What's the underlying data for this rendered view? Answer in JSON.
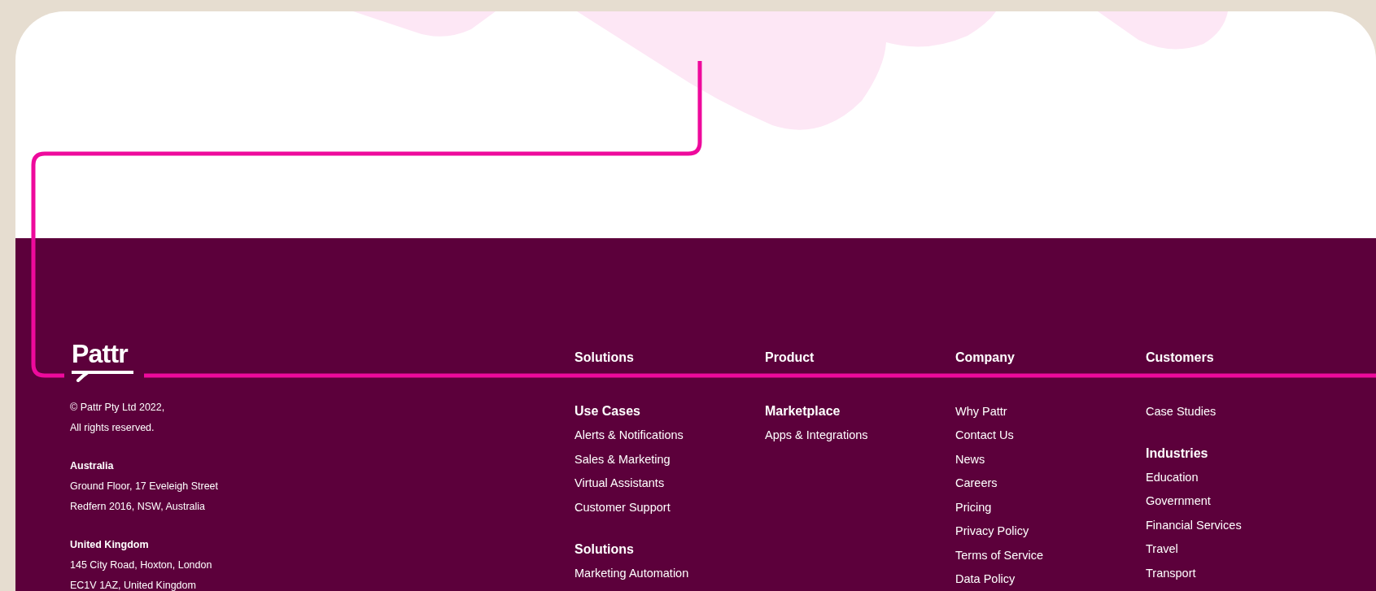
{
  "footer": {
    "logo": "Pattr",
    "copyright": [
      "© Pattr Pty Ltd 2022,",
      "All rights reserved."
    ],
    "offices": [
      {
        "name": "Australia",
        "lines": [
          "Ground Floor, 17 Eveleigh Street",
          "Redfern 2016, NSW, Australia"
        ]
      },
      {
        "name": "United Kingdom",
        "lines": [
          "145 City Road, Hoxton, London",
          "EC1V 1AZ, United Kingdom"
        ]
      }
    ],
    "columns": [
      {
        "heading": "Solutions",
        "groups": [
          {
            "title": "Use Cases",
            "links": [
              "Alerts & Notifications",
              "Sales & Marketing",
              "Virtual Assistants",
              "Customer Support"
            ]
          },
          {
            "title": "Solutions",
            "links": [
              "Marketing Automation"
            ]
          }
        ]
      },
      {
        "heading": "Product",
        "groups": [
          {
            "title": "Marketplace",
            "links": [
              "Apps & Integrations"
            ]
          }
        ]
      },
      {
        "heading": "Company",
        "groups": [
          {
            "links": [
              "Why Pattr",
              "Contact Us",
              "News",
              "Careers",
              "Pricing",
              "Privacy Policy",
              "Terms of Service",
              "Data Policy"
            ]
          }
        ]
      },
      {
        "heading": "Customers",
        "groups": [
          {
            "links": [
              "Case Studies"
            ]
          },
          {
            "title": "Industries",
            "links": [
              "Education",
              "Government",
              "Financial Services",
              "Travel",
              "Transport"
            ]
          }
        ]
      }
    ]
  }
}
